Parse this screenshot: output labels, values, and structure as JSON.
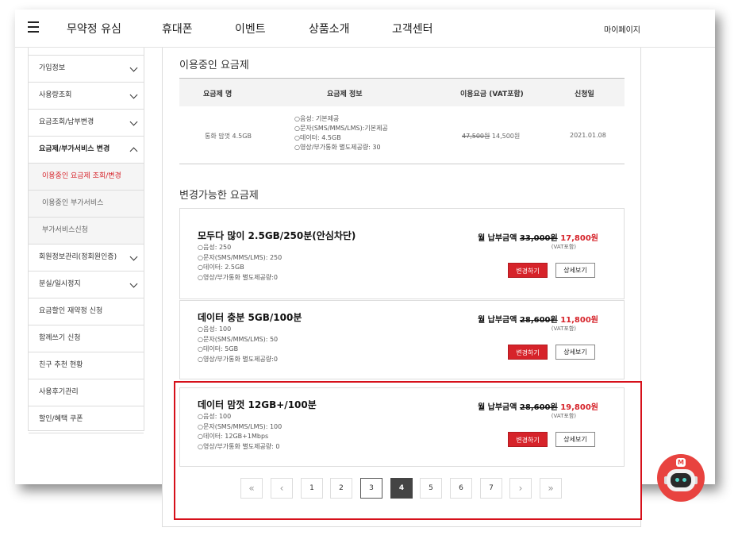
{
  "header": {
    "menu_icon": "hamburger-menu-icon",
    "nav": [
      "무약정 유심",
      "휴대폰",
      "이벤트",
      "상품소개",
      "고객센터"
    ],
    "mypage": "마이페이지"
  },
  "sidebar": {
    "items": [
      {
        "label": "가입정보"
      },
      {
        "label": "사용량조회"
      },
      {
        "label": "요금조회/납부변경"
      },
      {
        "label": "요금제/부가서비스 변경"
      },
      {
        "label": "이용중인 요금제 조회/변경"
      },
      {
        "label": "이용중인 부가서비스"
      },
      {
        "label": "부가서비스신청"
      },
      {
        "label": "회원정보관리(정회원인증)"
      },
      {
        "label": "분실/일시정지"
      },
      {
        "label": "요금할인 재약정 신청"
      },
      {
        "label": "함께쓰기 신청"
      },
      {
        "label": "친구 추천 현황"
      },
      {
        "label": "사용후기관리"
      },
      {
        "label": "할인/혜택 쿠폰"
      }
    ]
  },
  "current": {
    "title": "이용중인 요금제",
    "headers": [
      "요금제 명",
      "요금제 정보",
      "이용요금 (VAT포함)",
      "신청일"
    ],
    "row": {
      "name": "통화 맘껏 4.5GB",
      "info": [
        "○음성: 기본제공",
        "○문자(SMS/MMS/LMS):기본제공",
        "○데이터: 4.5GB",
        "○영상/부가통화 별도제공량: 30"
      ],
      "old_price": "47,500원",
      "new_price": "14,500원",
      "date": "2021.01.08"
    }
  },
  "available": {
    "title": "변경가능한 요금제",
    "price_label": "월 납부금액",
    "vat": "(VAT포함)",
    "change_label": "변경하기",
    "detail_label": "상세보기",
    "plans": [
      {
        "name": "모두다 많이 2.5GB/250분(안심차단)",
        "features": [
          "○음성: 250",
          "○문자(SMS/MMS/LMS): 250",
          "○데이터: 2.5GB",
          "○영상/부가통화 별도제공량:0"
        ],
        "old_price": "33,000원",
        "new_price": "17,800원"
      },
      {
        "name": "데이터 충분 5GB/100분",
        "features": [
          "○음성: 100",
          "○문자(SMS/MMS/LMS): 50",
          "○데이터: 5GB",
          "○영상/부가통화 별도제공량:0"
        ],
        "old_price": "28,600원",
        "new_price": "11,800원"
      },
      {
        "name": "데이터 맘껏 12GB+/100분",
        "features": [
          "○음성: 100",
          "○문자(SMS/MMS/LMS): 100",
          "○데이터: 12GB+1Mbps",
          "○영상/부가통화 별도제공량: 0"
        ],
        "old_price": "28,600원",
        "new_price": "19,800원"
      }
    ]
  },
  "pagination": {
    "first": "«",
    "prev": "‹",
    "pages": [
      "1",
      "2",
      "3",
      "4",
      "5",
      "6",
      "7"
    ],
    "next": "›",
    "last": "»",
    "current": "4"
  },
  "chatbot": {
    "badge": "M",
    "icon": "chatbot-robot-icon"
  },
  "colors": {
    "accent": "#d6232a",
    "highlight": "#d6101a",
    "bot": "#e8433f"
  }
}
